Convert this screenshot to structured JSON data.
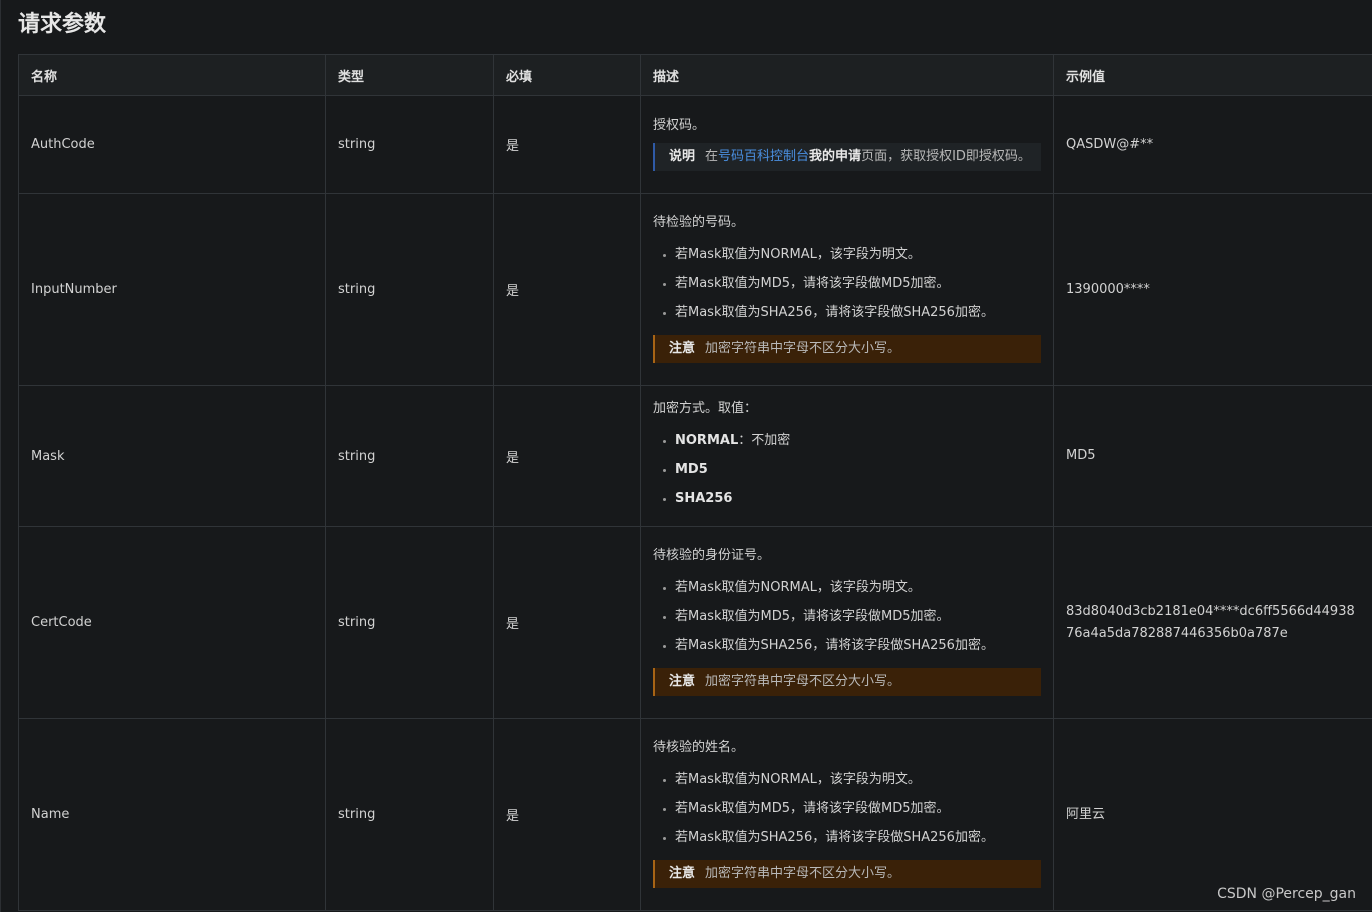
{
  "section": {
    "title": "请求参数"
  },
  "table": {
    "headers": {
      "name": "名称",
      "type": "类型",
      "required": "必填",
      "description": "描述",
      "example": "示例值"
    },
    "rows": [
      {
        "name": "AuthCode",
        "type": "string",
        "required": "是",
        "desc_main": "授权码。",
        "note": {
          "label": "说明",
          "prefix": "在",
          "link": "号码百科控制台",
          "strong": "我的申请",
          "suffix": "页面，获取授权ID即授权码。"
        },
        "example": "QASDW@#**"
      },
      {
        "name": "InputNumber",
        "type": "string",
        "required": "是",
        "desc_main": "待检验的号码。",
        "bullets": [
          "若Mask取值为NORMAL，该字段为明文。",
          "若Mask取值为MD5，请将该字段做MD5加密。",
          "若Mask取值为SHA256，请将该字段做SHA256加密。"
        ],
        "note": {
          "label": "注意",
          "text": "加密字符串中字母不区分大小写。"
        },
        "example": "1390000****"
      },
      {
        "name": "Mask",
        "type": "string",
        "required": "是",
        "desc_main": "加密方式。取值：",
        "options": [
          {
            "key": "NORMAL",
            "text": "：不加密"
          },
          {
            "key": "MD5",
            "text": ""
          },
          {
            "key": "SHA256",
            "text": ""
          }
        ],
        "example": "MD5"
      },
      {
        "name": "CertCode",
        "type": "string",
        "required": "是",
        "desc_main": "待核验的身份证号。",
        "bullets": [
          "若Mask取值为NORMAL，该字段为明文。",
          "若Mask取值为MD5，请将该字段做MD5加密。",
          "若Mask取值为SHA256，请将该字段做SHA256加密。"
        ],
        "note": {
          "label": "注意",
          "text": "加密字符串中字母不区分大小写。"
        },
        "example": "83d8040d3cb2181e04****dc6ff5566d4493876a4a5da782887446356b0a787e"
      },
      {
        "name": "Name",
        "type": "string",
        "required": "是",
        "desc_main": "待核验的姓名。",
        "bullets": [
          "若Mask取值为NORMAL，该字段为明文。",
          "若Mask取值为MD5，请将该字段做MD5加密。",
          "若Mask取值为SHA256，请将该字段做SHA256加密。"
        ],
        "note": {
          "label": "注意",
          "text": "加密字符串中字母不区分大小写。"
        },
        "example": "阿里云"
      }
    ]
  },
  "watermark": "CSDN @Percep_gan",
  "colors": {
    "background": "#17191b",
    "header_bg": "#1d2022",
    "border": "#303438",
    "link": "#4a8fe0",
    "warn_bg": "#3a2108",
    "warn_border": "#a86415",
    "info_border": "#2f5aa6"
  }
}
